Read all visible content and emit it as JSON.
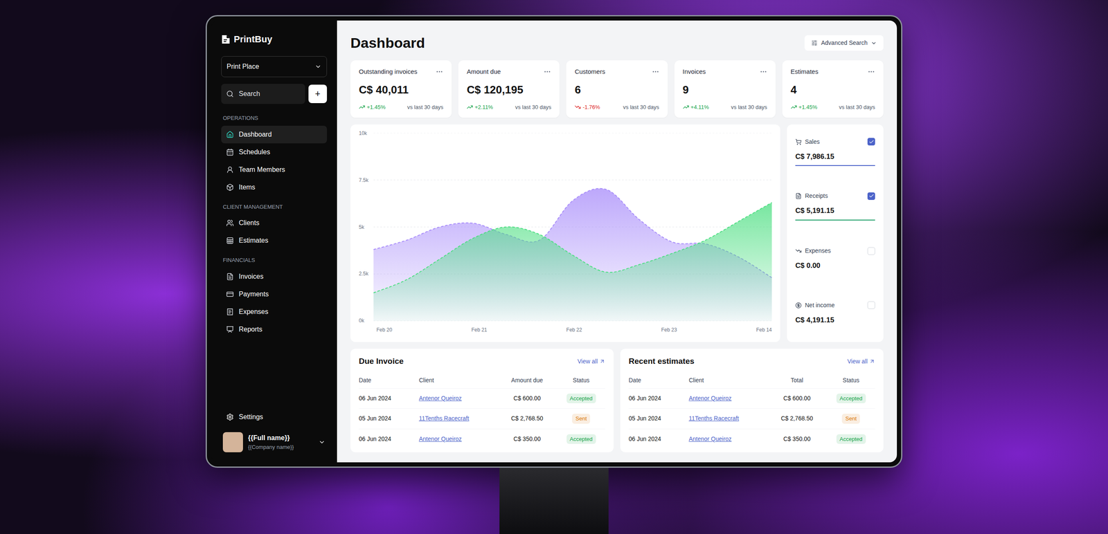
{
  "sidebar": {
    "brand": "PrintBuy",
    "workspace": "Print Place",
    "search": {
      "placeholder": "Search"
    },
    "add_button": "+",
    "sections": [
      {
        "title": "OPERATIONS",
        "items": [
          {
            "label": "Dashboard",
            "selected": true
          },
          {
            "label": "Schedules",
            "selected": false
          },
          {
            "label": "Team Members",
            "selected": false
          },
          {
            "label": "Items",
            "selected": false
          }
        ]
      },
      {
        "title": "CLIENT MANAGEMENT",
        "items": [
          {
            "label": "Clients",
            "selected": false
          },
          {
            "label": "Estimates",
            "selected": false
          }
        ]
      },
      {
        "title": "FINANCIALS",
        "items": [
          {
            "label": "Invoices",
            "selected": false
          },
          {
            "label": "Payments",
            "selected": false
          },
          {
            "label": "Expenses",
            "selected": false
          },
          {
            "label": "Reports",
            "selected": false
          }
        ]
      }
    ],
    "settings": "Settings",
    "user": {
      "name": "{{Full name}}",
      "company": "{{Company name}}"
    }
  },
  "header": {
    "title": "Dashboard",
    "advanced_search": "Advanced Search"
  },
  "stats": [
    {
      "title": "Outstanding invoices",
      "value": "C$ 40,011",
      "change": "+1.45%",
      "trend": "up",
      "note": "vs last 30 days"
    },
    {
      "title": "Amount due",
      "value": "C$ 120,195",
      "change": "+2.11%",
      "trend": "up",
      "note": "vs last 30 days"
    },
    {
      "title": "Customers",
      "value": "6",
      "change": "-1.76%",
      "trend": "down",
      "note": "vs last 30 days"
    },
    {
      "title": "Invoices",
      "value": "9",
      "change": "+4.11%",
      "trend": "up",
      "note": "vs last 30 days"
    },
    {
      "title": "Estimates",
      "value": "4",
      "change": "+1.45%",
      "trend": "up",
      "note": "vs last 30 days"
    }
  ],
  "chart": {
    "y_ticks": [
      "10k",
      "7.5k",
      "5k",
      "2.5k",
      "0k"
    ],
    "x_ticks": [
      "Feb 20",
      "Feb 21",
      "Feb 22",
      "Feb 23",
      "Feb 14"
    ],
    "series": [
      {
        "name": "Sales",
        "color": "#a78bfa",
        "values": [
          3800,
          4300,
          5000,
          5200,
          4600,
          4300,
          6400,
          7000,
          5400,
          4200,
          4100,
          3400,
          2300
        ]
      },
      {
        "name": "Receipts",
        "color": "#4ade80",
        "values": [
          1500,
          2200,
          3300,
          4400,
          5000,
          4600,
          3500,
          2600,
          3000,
          3600,
          4300,
          5300,
          6300
        ]
      }
    ]
  },
  "legend": [
    {
      "label": "Sales",
      "value": "C$ 7,986.15",
      "checked": true,
      "color": "#4c63c9"
    },
    {
      "label": "Receipts",
      "value": "C$ 5,191.15",
      "checked": true,
      "color": "#22a06b"
    },
    {
      "label": "Expenses",
      "value": "C$ 0.00",
      "checked": false,
      "color": "#9ca3af"
    },
    {
      "label": "Net income",
      "value": "C$ 4,191.15",
      "checked": false,
      "color": "#9ca3af"
    }
  ],
  "due_invoices": {
    "title": "Due Invoice",
    "view_all": "View all",
    "columns": [
      "Date",
      "Client",
      "Amount due",
      "Status"
    ],
    "rows": [
      {
        "date": "06 Jun 2024",
        "client": "Antenor Queiroz",
        "amount": "C$ 600.00",
        "status": "Accepted",
        "color": "#16a34a"
      },
      {
        "date": "05 Jun 2024",
        "client": "11Tenths Racecraft",
        "amount": "C$ 2,768.50",
        "status": "Sent",
        "color": "#d97706"
      },
      {
        "date": "06 Jun 2024",
        "client": "Antenor Queiroz",
        "amount": "C$ 350.00",
        "status": "Accepted",
        "color": "#16a34a"
      }
    ]
  },
  "recent_estimates": {
    "title": "Recent estimates",
    "view_all": "View all",
    "columns": [
      "Date",
      "Client",
      "Total",
      "Status"
    ],
    "rows": [
      {
        "date": "06 Jun 2024",
        "client": "Antenor Queiroz",
        "amount": "C$ 600.00",
        "status": "Accepted",
        "color": "#16a34a"
      },
      {
        "date": "05 Jun 2024",
        "client": "11Tenths Racecraft",
        "amount": "C$ 2,768.50",
        "status": "Sent",
        "color": "#d97706"
      },
      {
        "date": "06 Jun 2024",
        "client": "Antenor Queiroz",
        "amount": "C$ 350.00",
        "status": "Accepted",
        "color": "#16a34a"
      }
    ]
  }
}
